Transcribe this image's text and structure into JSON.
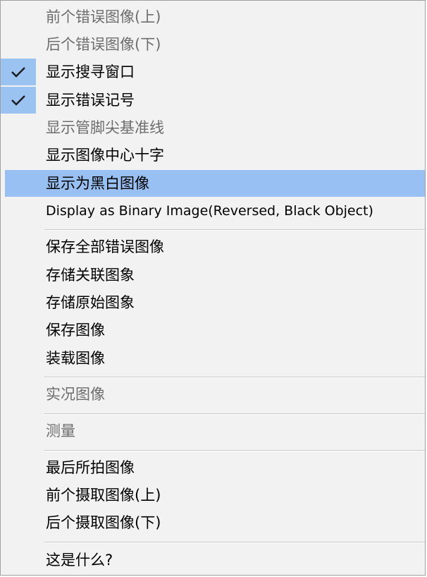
{
  "menu": {
    "items": [
      {
        "label": "前个错误图像(上)",
        "disabled": true,
        "checked": false
      },
      {
        "label": "后个错误图像(下)",
        "disabled": true,
        "checked": false
      },
      {
        "label": "显示搜寻窗口",
        "disabled": false,
        "checked": true
      },
      {
        "label": "显示错误记号",
        "disabled": false,
        "checked": true
      },
      {
        "label": "显示管脚尖基准线",
        "disabled": true,
        "checked": false
      },
      {
        "label": "显示图像中心十字",
        "disabled": false,
        "checked": false
      },
      {
        "label": "显示为黑白图像",
        "disabled": false,
        "checked": false,
        "highlighted": true
      },
      {
        "label": "Display as Binary Image(Reversed, Black Object)",
        "disabled": false,
        "checked": false
      },
      {
        "label": "保存全部错误图像",
        "disabled": false,
        "checked": false
      },
      {
        "label": "存储关联图象",
        "disabled": false,
        "checked": false
      },
      {
        "label": "存储原始图象",
        "disabled": false,
        "checked": false
      },
      {
        "label": "保存图像",
        "disabled": false,
        "checked": false
      },
      {
        "label": "装载图像",
        "disabled": false,
        "checked": false
      },
      {
        "label": "实况图像",
        "disabled": true,
        "checked": false
      },
      {
        "label": "测量",
        "disabled": true,
        "checked": false
      },
      {
        "label": "最后所拍图像",
        "disabled": false,
        "checked": false
      },
      {
        "label": "前个摄取图像(上)",
        "disabled": false,
        "checked": false
      },
      {
        "label": "后个摄取图像(下)",
        "disabled": false,
        "checked": false
      },
      {
        "label": "这是什么?",
        "disabled": false,
        "checked": false
      }
    ],
    "check_icon": "checkmark-icon",
    "colors": {
      "background": "#f2f2f2",
      "highlight": "#99c0f3",
      "checked_gutter": "#9ac3f2",
      "disabled_text": "#6d6d6d",
      "text": "#000000"
    }
  }
}
